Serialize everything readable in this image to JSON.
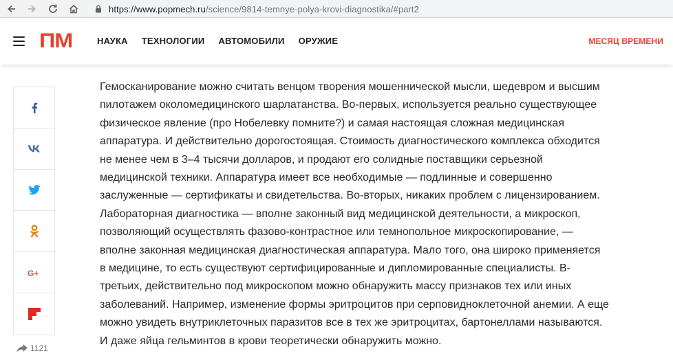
{
  "browser": {
    "url_main": "https://www.popmech.ru",
    "url_rest": "/science/9814-temnye-polya-krovi-diagnostika/#part2"
  },
  "header": {
    "logo": "ПМ",
    "nav": [
      "НАУКА",
      "ТЕХНОЛОГИИ",
      "АВТОМОБИЛИ",
      "ОРУЖИЕ"
    ],
    "special_link": "МЕСЯЦ ВРЕМЕНИ"
  },
  "share": {
    "buttons": [
      "facebook-icon",
      "vk-icon",
      "twitter-icon",
      "odnoklassniki-icon",
      "google-plus-icon",
      "flipboard-icon"
    ],
    "count": "1121"
  },
  "article": {
    "lines": [
      "Гемосканирование можно считать венцом творения мошеннической мысли, шедевром и высшим",
      "пилотажем околомедицинского шарлатанства. Во-первых, используется реально существующее",
      "физическое явление (про Нобелевку помните?) и самая настоящая сложная медицинская",
      "аппаратура. И действительно дорогостоящая. Стоимость диагностического комплекса обходится",
      "не менее чем в 3–4 тысячи долларов, и продают его солидные поставщики серьезной",
      "медицинской техники. Аппаратура имеет все необходимые — подлинные и совершенно",
      "заслуженные — сертификаты и свидетельства. Во-вторых, никаких проблем с лицензированием.",
      "Лабораторная диагностика — вполне законный вид медицинской деятельности, а микроскоп,",
      "позволяющий осуществлять фазово-контрастное или темнопольное микроскопирование, —",
      "вполне законная медицинская диагностическая аппаратура. Мало того, она широко применяется",
      "в медицине, то есть существуют сертифицированные и дипломированные специалисты. В-",
      "третьих, действительно под микроскопом можно обнаружить массу признаков тех или иных",
      "заболеваний. Например, изменение формы эритроцитов при серповидноклеточной анемии. А еще",
      "можно увидеть внутриклеточных паразитов все в тех же эритроцитах, бартонеллами называются.",
      "И даже яйца гельминтов в крови теоретически обнаружить можно."
    ]
  },
  "colors": {
    "brand": "#e8402e",
    "facebook": "#3b5998",
    "vk": "#4a76a8",
    "twitter": "#1da1f2",
    "odnoklassniki": "#ee8208",
    "google_plus": "#dd4b39",
    "flipboard": "#e12828"
  }
}
